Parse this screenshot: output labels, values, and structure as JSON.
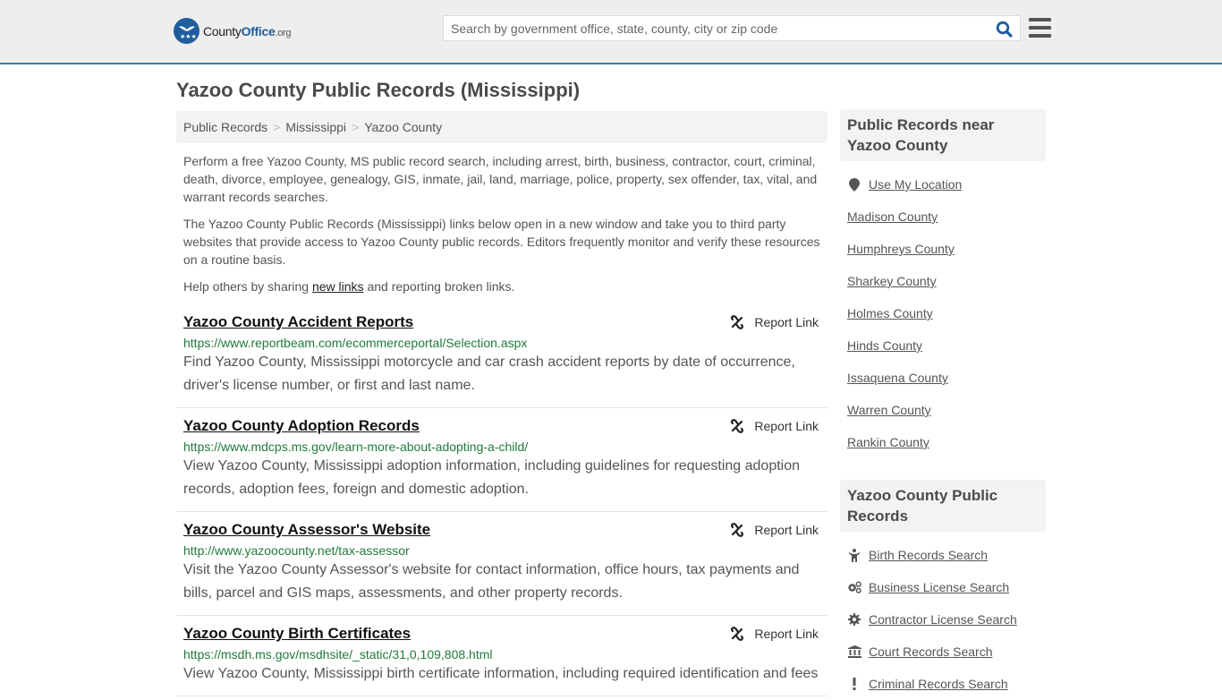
{
  "site": {
    "logo_county": "County",
    "logo_office": "Office",
    "logo_org": ".org"
  },
  "search": {
    "placeholder": "Search by government office, state, county, city or zip code",
    "value": ""
  },
  "page": {
    "title": "Yazoo County Public Records (Mississippi)"
  },
  "breadcrumb": [
    {
      "label": "Public Records"
    },
    {
      "label": "Mississippi"
    },
    {
      "label": "Yazoo County"
    }
  ],
  "breadcrumb_separator": ">",
  "intro": {
    "p1": "Perform a free Yazoo County, MS public record search, including arrest, birth, business, contractor, court, criminal, death, divorce, employee, genealogy, GIS, inmate, jail, land, marriage, police, property, sex offender, tax, vital, and warrant records searches.",
    "p2": "The Yazoo County Public Records (Mississippi) links below open in a new window and take you to third party websites that provide access to Yazoo County public records. Editors frequently monitor and verify these resources on a routine basis.",
    "p3_before": "Help others by sharing ",
    "p3_link": "new links",
    "p3_after": " and reporting broken links."
  },
  "report_label": "Report Link",
  "records": [
    {
      "title": "Yazoo County Accident Reports",
      "url": "https://www.reportbeam.com/ecommerceportal/Selection.aspx",
      "description": "Find Yazoo County, Mississippi motorcycle and car crash accident reports by date of occurrence, driver's license number, or first and last name."
    },
    {
      "title": "Yazoo County Adoption Records",
      "url": "https://www.mdcps.ms.gov/learn-more-about-adopting-a-child/",
      "description": "View Yazoo County, Mississippi adoption information, including guidelines for requesting adoption records, adoption fees, foreign and domestic adoption."
    },
    {
      "title": "Yazoo County Assessor's Website",
      "url": "http://www.yazoocounty.net/tax-assessor",
      "description": "Visit the Yazoo County Assessor's website for contact information, office hours, tax payments and bills, parcel and GIS maps, assessments, and other property records."
    },
    {
      "title": "Yazoo County Birth Certificates",
      "url": "https://msdh.ms.gov/msdhsite/_static/31,0,109,808.html",
      "description": "View Yazoo County, Mississippi birth certificate information, including required identification and fees"
    }
  ],
  "sidebar": {
    "nearby_heading": "Public Records near Yazoo County",
    "use_location": "Use My Location",
    "nearby": [
      "Madison County",
      "Humphreys County",
      "Sharkey County",
      "Holmes County",
      "Hinds County",
      "Issaquena County",
      "Warren County",
      "Rankin County"
    ],
    "county_heading": "Yazoo County Public Records",
    "county_links": [
      {
        "label": "Birth Records Search",
        "icon": "child-icon"
      },
      {
        "label": "Business License Search",
        "icon": "cogs-icon"
      },
      {
        "label": "Contractor License Search",
        "icon": "cog-icon"
      },
      {
        "label": "Court Records Search",
        "icon": "bank-icon"
      },
      {
        "label": "Criminal Records Search",
        "icon": "exclamation-icon"
      }
    ]
  },
  "colors": {
    "brand": "#1f5d9e",
    "header_border": "#3a7eaf",
    "url_green": "#217a3a"
  }
}
